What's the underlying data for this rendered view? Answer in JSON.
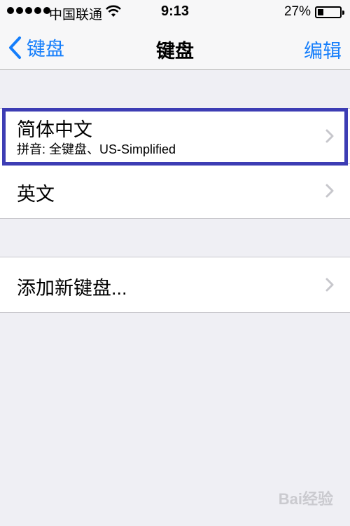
{
  "status_bar": {
    "carrier": "中国联通",
    "time": "9:13",
    "battery_percent": "27%",
    "battery_level": 0.27,
    "signal_dots": 5,
    "wifi": "wifi-icon"
  },
  "nav": {
    "back_label": "键盘",
    "title": "键盘",
    "edit_label": "编辑"
  },
  "keyboards": [
    {
      "title": "简体中文",
      "subtitle": "拼音: 全键盘、US-Simplified",
      "highlighted": true
    },
    {
      "title": "英文"
    }
  ],
  "add_keyboard": {
    "title": "添加新键盘..."
  },
  "watermark": "Bai经验"
}
